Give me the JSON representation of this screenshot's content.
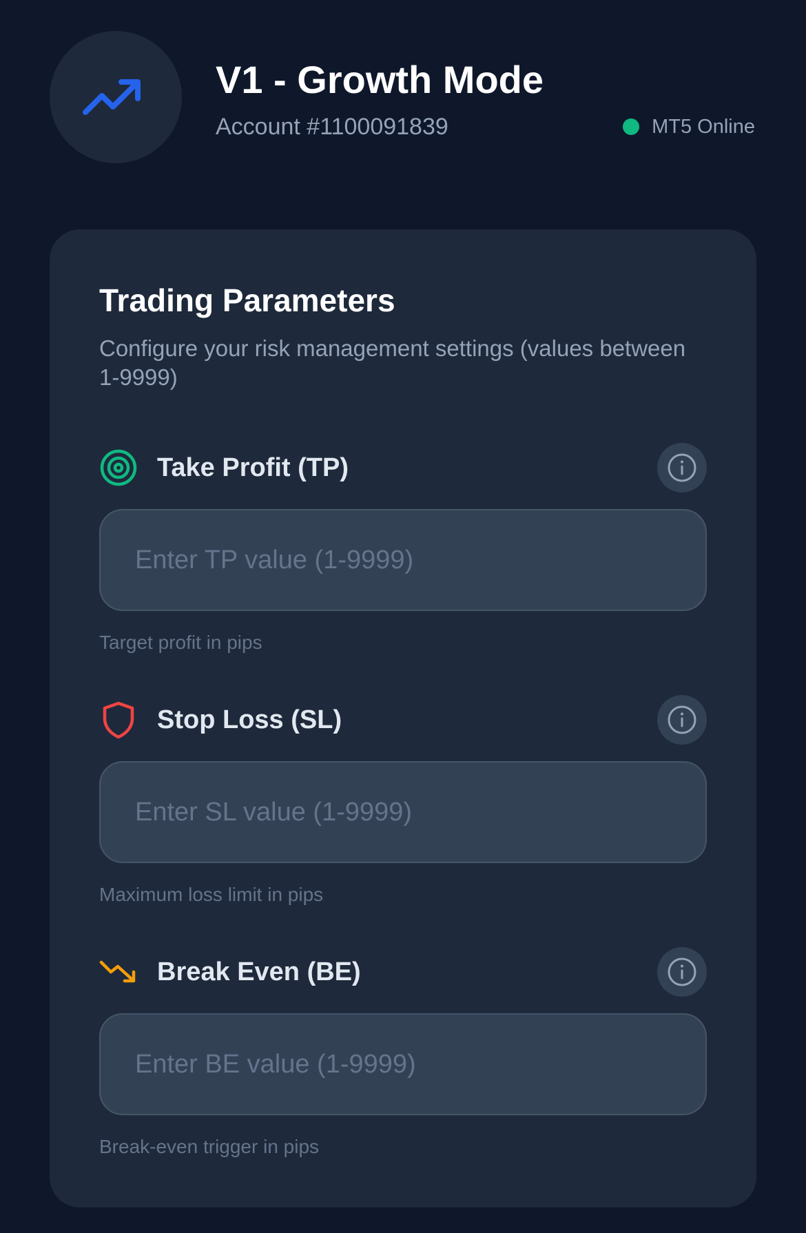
{
  "header": {
    "title": "V1 - Growth Mode",
    "account": "Account #1100091839",
    "status_text": "MT5 Online",
    "status_color": "#10b981",
    "logo_icon": "trending-up-icon",
    "accent_color": "#2563eb"
  },
  "card": {
    "title": "Trading Parameters",
    "subtitle": "Configure your risk management settings (values between 1-9999)"
  },
  "fields": [
    {
      "label": "Take Profit (TP)",
      "icon": "target-icon",
      "icon_color": "#10b981",
      "placeholder": "Enter TP value (1-9999)",
      "value": "",
      "help": "Target profit in pips"
    },
    {
      "label": "Stop Loss (SL)",
      "icon": "shield-icon",
      "icon_color": "#ef4444",
      "placeholder": "Enter SL value (1-9999)",
      "value": "",
      "help": "Maximum loss limit in pips"
    },
    {
      "label": "Break Even (BE)",
      "icon": "trending-down-icon",
      "icon_color": "#f59e0b",
      "placeholder": "Enter BE value (1-9999)",
      "value": "",
      "help": "Break-even trigger in pips"
    }
  ]
}
